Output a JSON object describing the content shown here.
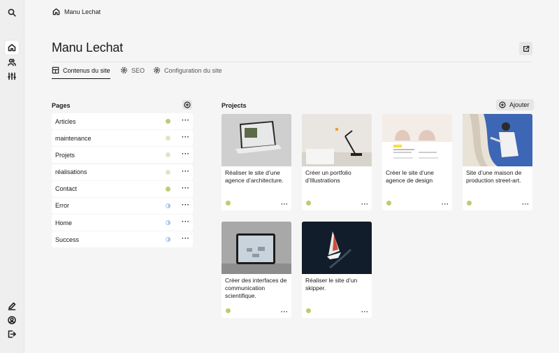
{
  "breadcrumb": {
    "site_name": "Manu Lechat"
  },
  "page": {
    "title": "Manu Lechat"
  },
  "tabs": [
    {
      "label": "Contenus du site",
      "icon": "layout-icon",
      "active": true
    },
    {
      "label": "SEO",
      "icon": "gear-icon",
      "active": false
    },
    {
      "label": "Configuration du site",
      "icon": "gear-icon",
      "active": false
    }
  ],
  "pages_section": {
    "title": "Pages",
    "items": [
      {
        "label": "Articles",
        "status_color": "#b6cf72"
      },
      {
        "label": "maintenance",
        "status_color": "#dfe6c2"
      },
      {
        "label": "Projets",
        "status_color": "#dfe6c2"
      },
      {
        "label": "réalisations",
        "status_color": "#dfe6c2"
      },
      {
        "label": "Contact",
        "status_color": "#b6cf72"
      },
      {
        "label": "Error",
        "status": "half"
      },
      {
        "label": "Home",
        "status": "half"
      },
      {
        "label": "Success",
        "status": "half"
      }
    ],
    "more_label": "···"
  },
  "projects_section": {
    "title": "Projects",
    "add_label": "Ajouter",
    "cards": [
      {
        "title": "Réaliser le site d’une agence d’architecture.",
        "status_color": "#b6cf72"
      },
      {
        "title": "Créer un portfolio d’Illustrations",
        "status_color": "#b6cf72"
      },
      {
        "title": "Créer le site d’une agence de design",
        "status_color": "#b6cf72"
      },
      {
        "title": "Site d’une maison de production street-art.",
        "status_color": "#b6cf72"
      },
      {
        "title": "Créer des interfaces de communication scientifique.",
        "status_color": "#b6cf72"
      },
      {
        "title": "Réaliser le site d’un skipper.",
        "status_color": "#b6cf72"
      }
    ],
    "more_label": "···"
  }
}
